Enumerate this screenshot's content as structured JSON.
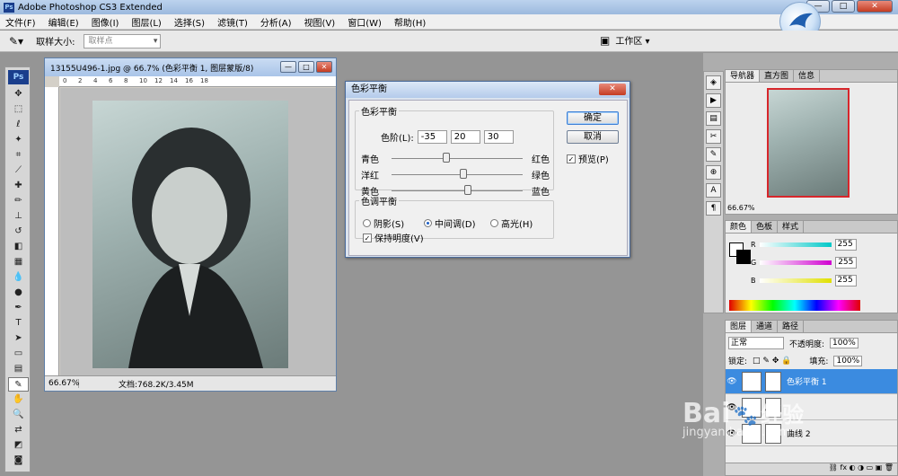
{
  "app": {
    "title": "Adobe Photoshop CS3 Extended",
    "ps_badge": "Ps"
  },
  "window_buttons": {
    "minimize": "—",
    "maximize": "□",
    "close": "✕"
  },
  "menu": [
    "文件(F)",
    "编辑(E)",
    "图像(I)",
    "图层(L)",
    "选择(S)",
    "滤镜(T)",
    "分析(A)",
    "视图(V)",
    "窗口(W)",
    "帮助(H)"
  ],
  "options": {
    "sample_label": "取样大小:",
    "sample_value": "取样点",
    "workspace_label": "工作区 ▾"
  },
  "document": {
    "title": "13155U496-1.jpg @ 66.7% (色彩平衡 1, 图层蒙版/8)",
    "zoom": "66.67%",
    "info": "文档:768.2K/3.45M",
    "ruler_marks": [
      "0",
      "2",
      "4",
      "6",
      "8",
      "10",
      "12",
      "14",
      "16",
      "18"
    ]
  },
  "dialog": {
    "title": "色彩平衡",
    "close": "✕",
    "color_balance_group": "色彩平衡",
    "levels_label": "色阶(L):",
    "levels": [
      "-35",
      "20",
      "30"
    ],
    "sliders": [
      {
        "left": "青色",
        "right": "红色",
        "pos": 0.42
      },
      {
        "left": "洋红",
        "right": "绿色",
        "pos": 0.55
      },
      {
        "left": "黄色",
        "right": "蓝色",
        "pos": 0.58
      }
    ],
    "tone_group": "色调平衡",
    "tone_options": [
      "阴影(S)",
      "中间调(D)",
      "高光(H)"
    ],
    "tone_selected": 1,
    "preserve_luminosity": "保持明度(V)",
    "ok": "确定",
    "cancel": "取消",
    "preview": "预览(P)"
  },
  "navigator": {
    "tabs": [
      "导航器",
      "直方图",
      "信息"
    ],
    "zoom": "66.67%"
  },
  "color_panel": {
    "tabs": [
      "颜色",
      "色板",
      "样式"
    ],
    "channels": [
      {
        "label": "R",
        "value": "255",
        "color": "#00c8c8"
      },
      {
        "label": "G",
        "value": "255",
        "color": "#d000d0"
      },
      {
        "label": "B",
        "value": "255",
        "color": "#e0e000"
      }
    ]
  },
  "layers_panel": {
    "tabs": [
      "图层",
      "通道",
      "路径"
    ],
    "blend_mode": "正常",
    "opacity_label": "不透明度:",
    "opacity": "100%",
    "lock_label": "锁定:",
    "fill_label": "填充:",
    "fill": "100%",
    "layers": [
      {
        "name": "色彩平衡 1",
        "selected": true
      },
      {
        "name": "",
        "selected": false
      },
      {
        "name": "曲线 2",
        "selected": false
      }
    ]
  },
  "watermark": {
    "brand": "Bai",
    "brand2": "经验",
    "url": "jingyan.baidu.com"
  }
}
